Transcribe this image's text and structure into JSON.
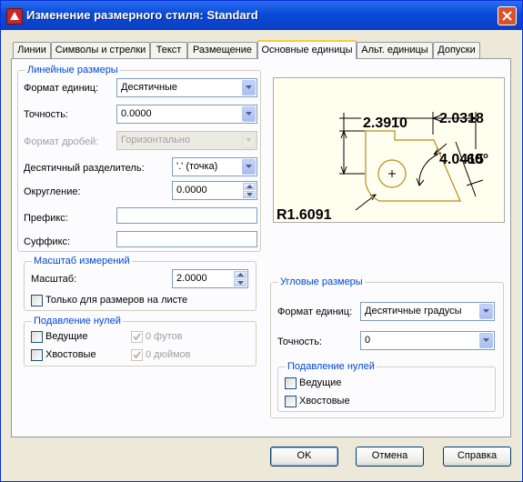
{
  "title": "Изменение размерного стиля: Standard",
  "tabs": [
    "Линии",
    "Символы и стрелки",
    "Текст",
    "Размещение",
    "Основные единицы",
    "Альт. единицы",
    "Допуски"
  ],
  "linear": {
    "group_title": "Линейные размеры",
    "unit_format_label": "Формат единиц:",
    "unit_format_value": "Десятичные",
    "precision_label": "Точность:",
    "precision_value": "0.0000",
    "fraction_format_label": "Формат дробей:",
    "fraction_format_value": "Горизонтально",
    "decimal_sep_label": "Десятичный  разделитель:",
    "decimal_sep_value": "'.' (точка)",
    "round_label": "Округление:",
    "round_value": "0.0000",
    "prefix_label": "Префикс:",
    "prefix_value": "",
    "suffix_label": "Суффикс:",
    "suffix_value": ""
  },
  "scale": {
    "group_title": "Масштаб измерений",
    "scale_label": "Масштаб:",
    "scale_value": "2.0000",
    "layout_only_label": "Только для размеров на листе"
  },
  "zero_linear": {
    "group_title": "Подавление нулей",
    "leading_label": "Ведущие",
    "trailing_label": "Хвостовые",
    "feet_label": "0 футов",
    "inches_label": "0 дюймов"
  },
  "preview": {
    "dim_a": "2.3910",
    "dim_b": "2.0318",
    "dim_c": "4.0415",
    "dim_c_over": "60°",
    "radius": "R1.6091"
  },
  "angular": {
    "group_title": "Угловые размеры",
    "unit_format_label": "Формат единиц:",
    "unit_format_value": "Десятичные градусы",
    "precision_label": "Точность:",
    "precision_value": "0"
  },
  "zero_angular": {
    "group_title": "Подавление нулей",
    "leading_label": "Ведущие",
    "trailing_label": "Хвостовые"
  },
  "buttons": {
    "ok": "OK",
    "cancel": "Отмена",
    "help": "Справка"
  }
}
